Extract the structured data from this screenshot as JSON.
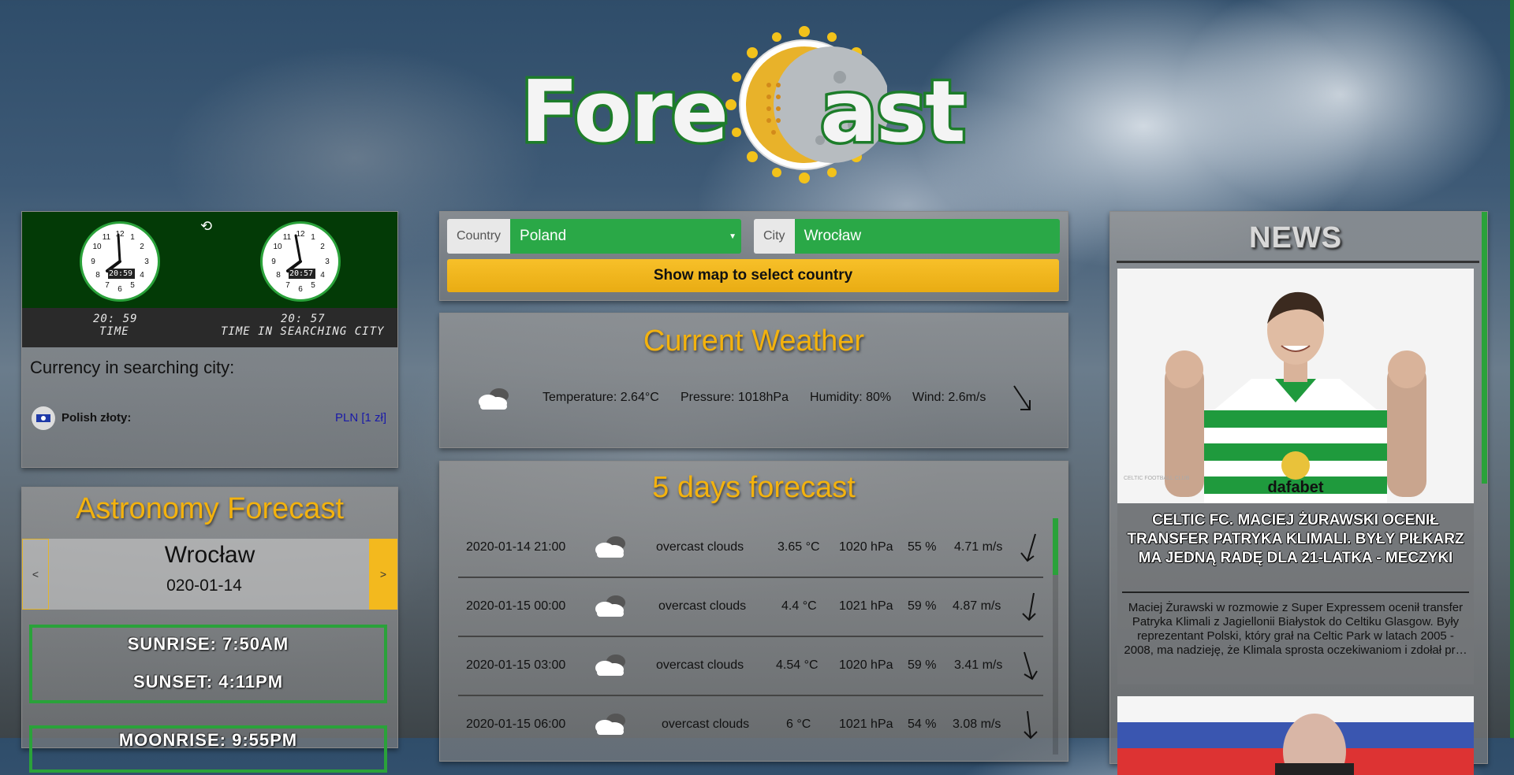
{
  "logo": {
    "left_text": "Fore",
    "right_text": "ast"
  },
  "clock": {
    "local_digital": "20: 59",
    "local_label": "TIME",
    "city_digital": "20: 57",
    "city_label": "TIME IN SEARCHING CITY",
    "local_face_digital": "20:59",
    "city_face_digital": "20:57"
  },
  "currency": {
    "title": "Currency in searching city:",
    "name": "Polish złoty:",
    "code": "PLN [1 zł]"
  },
  "astronomy": {
    "title": "Astronomy Forecast",
    "prev": "<",
    "next": ">",
    "city": "Wrocław",
    "date": "020-01-14",
    "sunrise": "SUNRISE: 7:50AM",
    "sunset": "SUNSET: 4:11PM",
    "moonrise": "MOONRISE: 9:55PM"
  },
  "search": {
    "country_label": "Country",
    "country_value": "Poland",
    "city_label": "City",
    "city_value": "Wrocław",
    "map_button": "Show map to select country"
  },
  "current": {
    "title": "Current Weather",
    "temperature": "Temperature: 2.64°C",
    "pressure": "Pressure: 1018hPa",
    "humidity": "Humidity: 80%",
    "wind": "Wind: 2.6m/s"
  },
  "forecast": {
    "title": "5 days forecast",
    "rows": [
      {
        "datetime": "2020-01-14 21:00",
        "desc": "overcast clouds",
        "temp": "3.65 °C",
        "pressure": "1020 hPa",
        "humidity": "55 %",
        "wind": "4.71 m/s"
      },
      {
        "datetime": "2020-01-15 00:00",
        "desc": "overcast clouds",
        "temp": "4.4 °C",
        "pressure": "1021 hPa",
        "humidity": "59 %",
        "wind": "4.87 m/s"
      },
      {
        "datetime": "2020-01-15 03:00",
        "desc": "overcast clouds",
        "temp": "4.54 °C",
        "pressure": "1020 hPa",
        "humidity": "59 %",
        "wind": "3.41 m/s"
      },
      {
        "datetime": "2020-01-15 06:00",
        "desc": "overcast clouds",
        "temp": "6 °C",
        "pressure": "1021 hPa",
        "humidity": "54 %",
        "wind": "3.08 m/s"
      }
    ]
  },
  "news": {
    "title": "NEWS",
    "headline": "CELTIC FC. MACIEJ ŻURAWSKI OCENIŁ TRANSFER PATRYKA KLIMALI. BYŁY PIŁKARZ MA JEDNĄ RADĘ DLA 21-LATKA - MECZYKI",
    "body": "Maciej Żurawski w rozmowie z Super Expressem ocenił transfer Patryka Klimali z Jagiellonii Białystok do Celtiku Glasgow. Były reprezentant Polski, który grał na Celtic Park w latach 2005 - 2008, ma nadzieję, że Klimala sprosta oczekiwaniom i zdołał pr…",
    "jersey_sponsor": "dafabet",
    "club_mark": "CELTIC FOOTBALL CLUB"
  },
  "colors": {
    "accent": "#f3b20e",
    "green": "#2aa847",
    "dark_green": "#033a06"
  }
}
